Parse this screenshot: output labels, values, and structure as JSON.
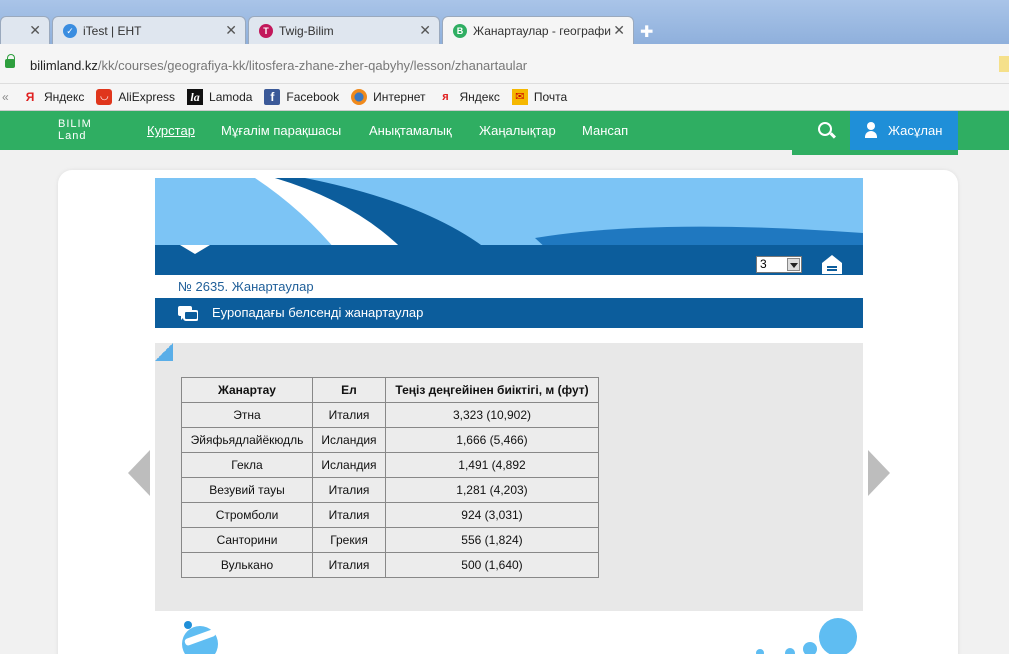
{
  "browser": {
    "tabs": [
      {
        "label": "",
        "active": false
      },
      {
        "label": "iTest | ЕНТ",
        "active": false
      },
      {
        "label": "Twig-Bilim",
        "active": false
      },
      {
        "label": "Жанартаулар - географи",
        "active": true
      }
    ],
    "url_host": "bilimland.kz",
    "url_path": "/kk/courses/geografiya-kk/litosfera-zhane-zher-qabyhy/lesson/zhanartaular",
    "bookmarks": [
      {
        "label": "Яндекс",
        "icon": "yandex-icon"
      },
      {
        "label": "AliExpress",
        "icon": "aliexpress-icon"
      },
      {
        "label": "Lamoda",
        "icon": "lamoda-icon"
      },
      {
        "label": "Facebook",
        "icon": "facebook-icon"
      },
      {
        "label": "Интернет",
        "icon": "firefox-icon"
      },
      {
        "label": "Яндекс",
        "icon": "yandex-browser-icon"
      },
      {
        "label": "Почта",
        "icon": "mail-icon"
      }
    ]
  },
  "site": {
    "logo_line1": "BILIM",
    "logo_line2": "Land",
    "nav": [
      {
        "label": "Курстар",
        "active": true
      },
      {
        "label": "Мұғалім парақшасы",
        "active": false
      },
      {
        "label": "Анықтамалық",
        "active": false
      },
      {
        "label": "Жаңалықтар",
        "active": false
      },
      {
        "label": "Мансап",
        "active": false
      }
    ],
    "user_label": "Жасұлан",
    "accent": "#2fae62",
    "blue": "#0c5d9c"
  },
  "lesson": {
    "page_select": "3",
    "title": "№ 2635. Жанартаулар",
    "section_title": "Еуропадағы белсенді жанартаулар"
  },
  "table": {
    "headers": [
      "Жанартау",
      "Ел",
      "Теңіз деңгейінен биіктігі, м (фут)"
    ],
    "rows": [
      [
        "Этна",
        "Италия",
        "3,323 (10,902)"
      ],
      [
        "Эйяфьядлайёкюдль",
        "Исландия",
        "1,666 (5,466)"
      ],
      [
        "Гекла",
        "Исландия",
        "1,491 (4,892"
      ],
      [
        "Везувий тауы",
        "Италия",
        "1,281 (4,203)"
      ],
      [
        "Стромболи",
        "Италия",
        "924 (3,031)"
      ],
      [
        "Санторини",
        "Грекия",
        "556 (1,824)"
      ],
      [
        "Вулькано",
        "Италия",
        "500 (1,640)"
      ]
    ]
  }
}
